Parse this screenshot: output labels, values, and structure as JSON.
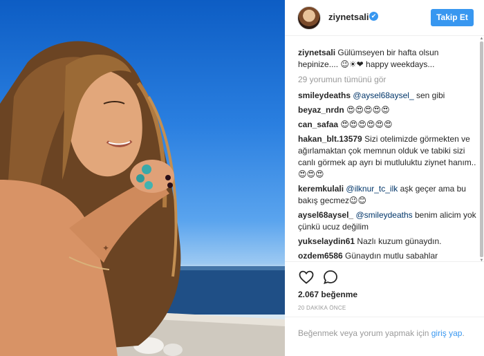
{
  "header": {
    "username": "ziynetsali",
    "verified_glyph": "✔",
    "follow_label": "Takip Et"
  },
  "caption": {
    "user": "ziynetsali",
    "text": "Gülümseyen bir hafta olsun hepinize.... 😉☀❤ happy weekdays..."
  },
  "load_more": "29 yorumun tümünü gör",
  "comments": [
    {
      "user": "smileydeaths",
      "mention": "@aysel68aysel_",
      "text": " sen gibi"
    },
    {
      "user": "beyaz_nrdn",
      "mention": "",
      "text": "😍😍😍😍😍"
    },
    {
      "user": "can_safaa",
      "mention": "",
      "text": "😍😍😍😍😍😍"
    },
    {
      "user": "hakan_blt.13579",
      "mention": "",
      "text": "Sizi otelimizde görmekten ve ağırlamaktan çok memnun olduk ve tabiki sizi canlı görmek ap ayrı bi mutluluktu ziynet hanım..😍😍😍"
    },
    {
      "user": "keremkulali",
      "mention": "@ilknur_tc_ilk",
      "text": " aşk geçer ama bu bakış gecmez😉😊"
    },
    {
      "user": "aysel68aysel_",
      "mention": "@smileydeaths",
      "text": " benim alicim yok çünkü ucuz değilim"
    },
    {
      "user": "yukselaydin61",
      "mention": "",
      "text": "Nazlı kuzum günaydın."
    },
    {
      "user": "ozdem6586",
      "mention": "",
      "text": "Günaydın mutlu sabahlar"
    }
  ],
  "actions": {
    "like_icon": "heart-outline-icon",
    "comment_icon": "speech-bubble-icon",
    "likes": "2.067 beğenme",
    "timestamp": "20 DAKİKA ÖNCE"
  },
  "login_prompt": {
    "prefix": "Beğenmek veya yorum yapmak için ",
    "link": "giriş yap",
    "suffix": "."
  },
  "colors": {
    "accent": "#3897f0",
    "mention": "#003569",
    "muted": "#999999",
    "sky": "#2a7fe0"
  }
}
